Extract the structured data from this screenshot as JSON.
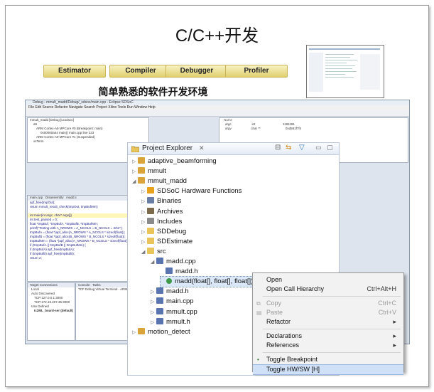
{
  "title": "C/C++开发",
  "subtitle": "简单熟悉的软件开发环境",
  "tools": [
    "Estimator",
    "Compiler",
    "Debugger",
    "Profiler"
  ],
  "ide": {
    "window_title": "Debug - mmult_madd/Debug/_sdsoc/main.cpp - Eclipse SDSoC",
    "menu": "File  Edit  Source  Refactor  Navigate  Search  Project  Xilinx Tools  Run  Window  Help",
    "debug_tree": [
      "mmult_madd [Debug [ucsdsoc]",
      "a9",
      "ARM Cortex-A9 MPCore #0 (Breakpoint: main)",
      "0x00000a44 main() main.cpp line 223",
      "ARM Cortex-A9 MPCore #1 (Suspended)",
      "xsTerm"
    ],
    "code_lines": [
      "apf_free(tmpOut);",
      "return mmult_result_check(tmpOut, tmpBufMm);",
      "int main(int argc, char* argv[])",
      "int test_passed = 0;",
      "float *tmpBuf, *tmpBufA, *tmpBufB, *tmpBufMm;",
      "printf(\"Testing with A_NROWS = A_NCOLS = B_NCOLS = 32\\n\");",
      "tmpBufA = (float *)apf_alloc(A_NROWS * A_NCOLS * sizeof(float));",
      "tmpBufB = (float *)apf_alloc(B_NROWS * B_NCOLS * sizeof(float));",
      "tmpBufMm = (float *)apf_alloc(A_NROWS * B_NCOLS * sizeof(float));",
      "if (!tmpBufA || !tmpBufB || !tmpBufMm) {",
      "if (tmpBufA) apf_free(tmpBufA);",
      "if (tmpBufB) apf_free(tmpBufB);",
      "return 2;"
    ],
    "variables": [
      {
        "name": "argc",
        "type": "int",
        "value": "1191181"
      },
      {
        "name": "argv",
        "type": "char **",
        "value": "0xd581f7f4"
      }
    ],
    "targets": [
      "Target Connections",
      "Local",
      "Auto Discovered",
      "TCP:127.0.0.1:3000",
      "TCP:172.19.207.35:3000",
      "Use Defined",
      "Ic2ML_board-ser (default)"
    ],
    "console_label": "TCF Debug Virtual Terminal - ARM Cortex-A9"
  },
  "explorer": {
    "header": "Project Explorer",
    "items": [
      {
        "label": "adaptive_beamforming",
        "icon": "project-icon",
        "indent": 0,
        "arrow": "▷"
      },
      {
        "label": "mmult",
        "icon": "project-icon",
        "indent": 0,
        "arrow": "▷"
      },
      {
        "label": "mmult_madd",
        "icon": "project-icon",
        "indent": 0,
        "arrow": "◢"
      },
      {
        "label": "SDSoC Hardware Functions",
        "icon": "lightning-icon",
        "indent": 1,
        "arrow": "▷"
      },
      {
        "label": "Binaries",
        "icon": "binaries-icon",
        "indent": 1,
        "arrow": "▷"
      },
      {
        "label": "Archives",
        "icon": "archives-icon",
        "indent": 1,
        "arrow": "▷"
      },
      {
        "label": "Includes",
        "icon": "includes-icon",
        "indent": 1,
        "arrow": "▷"
      },
      {
        "label": "SDDebug",
        "icon": "folder-icon",
        "indent": 1,
        "arrow": "▷"
      },
      {
        "label": "SDEstimate",
        "icon": "folder-icon",
        "indent": 1,
        "arrow": "▷"
      },
      {
        "label": "src",
        "icon": "folder-icon",
        "indent": 1,
        "arrow": "◢"
      },
      {
        "label": "madd.cpp",
        "icon": "cpp-file-icon",
        "indent": 2,
        "arrow": "◢"
      },
      {
        "label": "madd.h",
        "icon": "header-file-icon",
        "indent": 3,
        "arrow": ""
      },
      {
        "label": "madd(float[], float[], float[]) : void",
        "icon": "function-icon",
        "indent": 3,
        "arrow": ""
      },
      {
        "label": "madd.h",
        "icon": "header-file-icon",
        "indent": 2,
        "arrow": "▷"
      },
      {
        "label": "main.cpp",
        "icon": "cpp-file-icon",
        "indent": 2,
        "arrow": "▷"
      },
      {
        "label": "mmult.cpp",
        "icon": "cpp-file-icon",
        "indent": 2,
        "arrow": "▷"
      },
      {
        "label": "mmult.h",
        "icon": "header-file-icon",
        "indent": 2,
        "arrow": "▷"
      },
      {
        "label": "motion_detect",
        "icon": "project-icon",
        "indent": 0,
        "arrow": "▷"
      }
    ]
  },
  "context_menu": {
    "items": [
      {
        "label": "Open",
        "key": "",
        "disabled": false,
        "submenu": false,
        "sep_before": false,
        "active": false
      },
      {
        "label": "Open Call Hierarchy",
        "key": "Ctrl+Alt+H",
        "disabled": false,
        "submenu": false,
        "sep_before": false,
        "active": false
      },
      {
        "label": "Copy",
        "key": "Ctrl+C",
        "disabled": true,
        "submenu": false,
        "sep_before": true,
        "active": false
      },
      {
        "label": "Paste",
        "key": "Ctrl+V",
        "disabled": true,
        "submenu": false,
        "sep_before": false,
        "active": false
      },
      {
        "label": "Refactor",
        "key": "",
        "disabled": false,
        "submenu": true,
        "sep_before": false,
        "active": false
      },
      {
        "label": "Declarations",
        "key": "",
        "disabled": false,
        "submenu": true,
        "sep_before": true,
        "active": false
      },
      {
        "label": "References",
        "key": "",
        "disabled": false,
        "submenu": true,
        "sep_before": false,
        "active": false
      },
      {
        "label": "Toggle Breakpoint",
        "key": "",
        "disabled": false,
        "submenu": false,
        "sep_before": true,
        "active": false
      },
      {
        "label": "Toggle HW/SW [H]",
        "key": "",
        "disabled": false,
        "submenu": false,
        "sep_before": false,
        "active": true
      }
    ]
  },
  "colors": {
    "pill": "#e0cf6e",
    "selection": "#dbe8f8",
    "menu_active": "#cfe0f7"
  }
}
